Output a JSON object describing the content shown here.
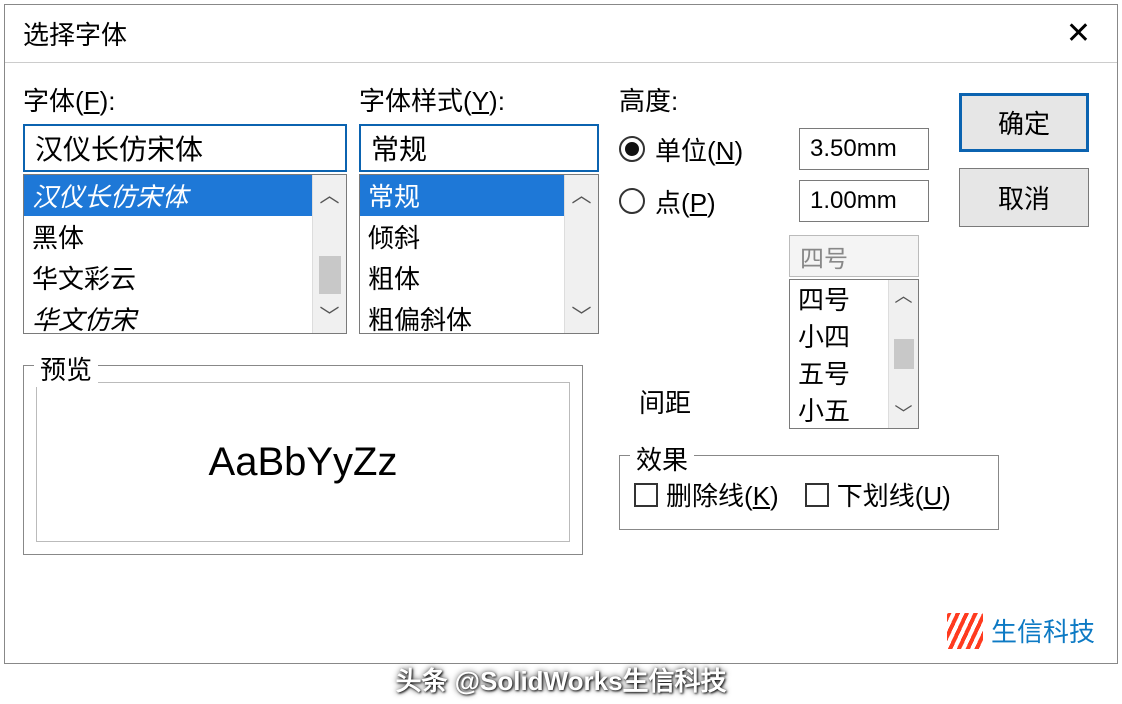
{
  "dialog": {
    "title": "选择字体"
  },
  "font": {
    "label": "字体",
    "hotkey": "F",
    "value": "汉仪长仿宋体",
    "items": [
      "汉仪长仿宋体",
      "黑体",
      "华文彩云",
      "华文仿宋"
    ],
    "selected_index": 0
  },
  "style": {
    "label": "字体样式",
    "hotkey": "Y",
    "value": "常规",
    "items": [
      "常规",
      "倾斜",
      "粗体",
      "粗偏斜体"
    ],
    "selected_index": 0
  },
  "height": {
    "label": "高度:",
    "unit": {
      "label": "单位",
      "hotkey": "N",
      "value": "3.50mm",
      "checked": true
    },
    "point": {
      "label": "点",
      "hotkey": "P",
      "value": "1.00mm",
      "checked": false
    },
    "size_value": "四号",
    "sizes": [
      "四号",
      "小四",
      "五号",
      "小五"
    ],
    "size_selected_index": 0,
    "spacing_label": "间距"
  },
  "buttons": {
    "ok": "确定",
    "cancel": "取消"
  },
  "preview": {
    "label": "预览",
    "sample": "AaBbYyZz"
  },
  "effects": {
    "label": "效果",
    "strikeout": {
      "label": "删除线",
      "hotkey": "K",
      "checked": false
    },
    "underline": {
      "label": "下划线",
      "hotkey": "U",
      "checked": false
    }
  },
  "logo": {
    "text": "生信科技"
  },
  "watermark": "头条 @SolidWorks生信科技"
}
